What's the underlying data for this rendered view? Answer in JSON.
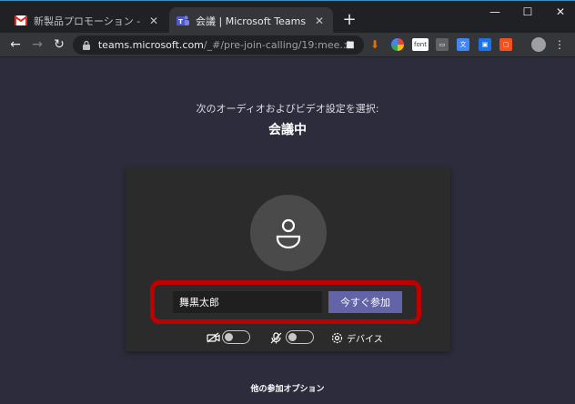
{
  "browser": {
    "tabs": [
      {
        "title": "新製品プロモーション - ykasugai@gi",
        "favicon": "gmail-icon",
        "active": false
      },
      {
        "title": "会議 | Microsoft Teams",
        "favicon": "teams-icon",
        "active": true
      }
    ],
    "url_host": "teams.microsoft.com",
    "url_rest": "/_#/pre-join-calling/19:mee..."
  },
  "page": {
    "subtitle": "次のオーディオおよびビデオ設定を選択:",
    "meeting_title": "会議中",
    "name_value": "舞黒太郎",
    "join_label": "今すぐ参加",
    "camera_on": false,
    "mic_on": false,
    "devices_label": "デバイス",
    "other_options": "他の参加オプション"
  },
  "colors": {
    "background": "#2d2c3c",
    "card": "#2b2b2b",
    "accent": "#6264a7",
    "highlight": "#c00000"
  }
}
